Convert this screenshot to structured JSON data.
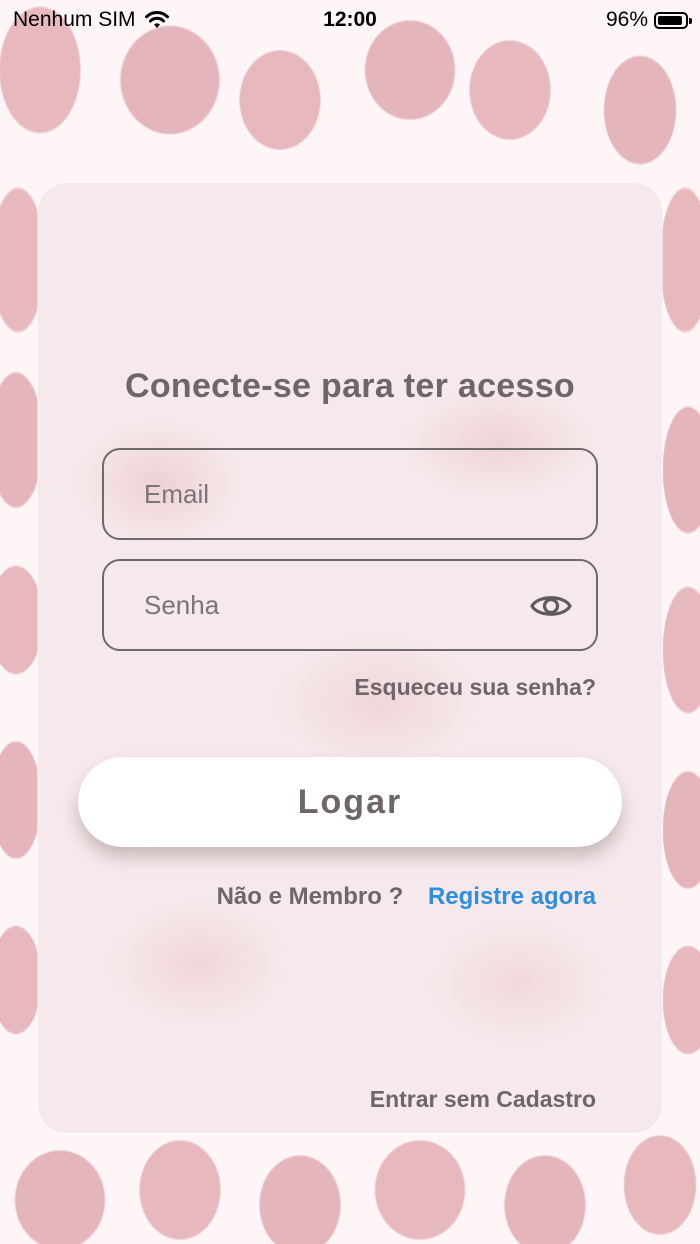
{
  "status_bar": {
    "carrier": "Nenhum SIM",
    "time": "12:00",
    "battery_percent": "96%",
    "icons": [
      "wifi-icon",
      "battery-icon"
    ]
  },
  "login": {
    "title": "Conecte-se para ter acesso",
    "email": {
      "placeholder": "Email",
      "value": ""
    },
    "password": {
      "placeholder": "Senha",
      "value": "",
      "toggle_icon": "eye-icon"
    },
    "forgot_password": "Esqueceu sua senha?",
    "login_button": "Logar",
    "register_prompt": "Não e Membro ?",
    "register_link": "Registre agora",
    "guest_link": "Entrar sem Cadastro"
  },
  "colors": {
    "text": "#6e6668",
    "link": "#2e8fe0",
    "background_pattern": "#e5b5bc",
    "card": "#f6e9eb",
    "button": "#ffffff"
  }
}
